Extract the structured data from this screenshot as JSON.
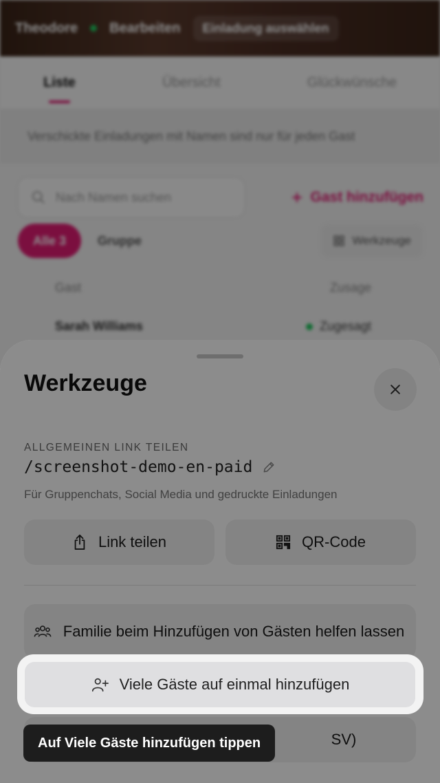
{
  "background": {
    "topbar": {
      "name": "Theodore",
      "edit_label": "Bearbeiten",
      "invite_label": "Einladung auswählen"
    },
    "tabs": [
      {
        "label": "Liste"
      },
      {
        "label": "Übersicht"
      },
      {
        "label": "Glückwünsche"
      }
    ],
    "info_text": "Verschickte Einladungen mit Namen sind nur für jeden Gast",
    "search_placeholder": "Nach Namen suchen",
    "add_guest_label": "Gast hinzufügen",
    "filter_all_label": "Alle 3",
    "filter_group_label": "Gruppe",
    "tools_label": "Werkzeuge",
    "table": {
      "col_guest": "Gast",
      "col_access": "Zusage",
      "rows": [
        {
          "name": "Sarah Williams",
          "status": "Zugesagt"
        }
      ]
    }
  },
  "sheet": {
    "title": "Werkzeuge",
    "section_label": "ALLGEMEINEN LINK TEILEN",
    "link_path": "/screenshot-demo-en-paid",
    "link_description": "Für Gruppenchats, Social Media und gedruckte Einladungen",
    "share_link_label": "Link teilen",
    "qr_code_label": "QR-Code",
    "family_help_label": "Familie beim Hinzufügen von Gästen helfen lassen",
    "bulk_add_label": "Viele Gäste auf einmal hinzufügen",
    "csv_partial_label": "SV)"
  },
  "tooltip": {
    "text": "Auf Viele Gäste hinzufügen tippen"
  },
  "colors": {
    "accent": "#e11d74",
    "tooltip_bg": "#1d1d1d",
    "sheet_bg": "#ffffff"
  }
}
